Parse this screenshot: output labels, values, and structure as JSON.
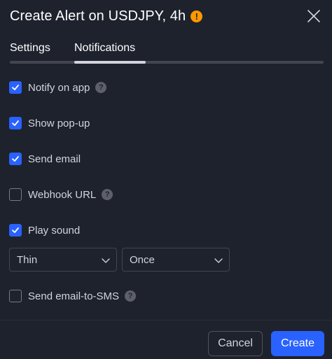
{
  "header": {
    "title": "Create Alert on USDJPY, 4h",
    "warning_glyph": "!"
  },
  "tabs": [
    {
      "label": "Settings",
      "active": false
    },
    {
      "label": "Notifications",
      "active": true
    }
  ],
  "notifications": {
    "notify_on_app": {
      "label": "Notify on app",
      "checked": true
    },
    "show_popup": {
      "label": "Show pop-up",
      "checked": true
    },
    "send_email": {
      "label": "Send email",
      "checked": true
    },
    "webhook_url": {
      "label": "Webhook URL",
      "checked": false
    },
    "play_sound": {
      "label": "Play sound",
      "checked": true
    },
    "send_email_sms": {
      "label": "Send email-to-SMS",
      "checked": false
    }
  },
  "sound": {
    "selected": "Thin",
    "repeat": "Once"
  },
  "help_glyph": "?",
  "footer": {
    "cancel_label": "Cancel",
    "create_label": "Create"
  },
  "colors": {
    "background": "#1e222d",
    "accent": "#2962ff",
    "warning": "#ff9800"
  }
}
